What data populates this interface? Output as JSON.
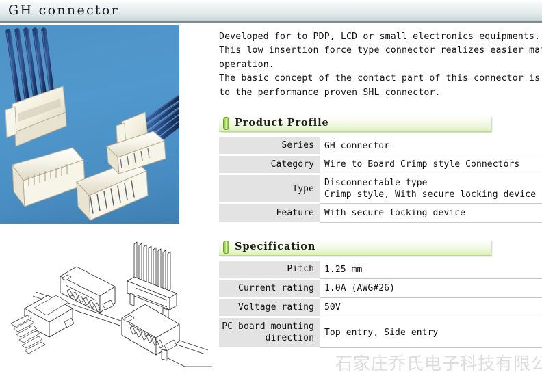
{
  "titlebar": {
    "title": "GH connector"
  },
  "photo": {
    "alt": "product-photo-gh-connector-wire-harness-and-headers"
  },
  "drawing": {
    "alt": "technical-line-drawing-gh-connector-assemblies"
  },
  "description": {
    "lines": [
      "Developed for to PDP, LCD or small electronics equipments.",
      "This low insertion force type connector realizes easier mating",
      "operation.",
      "The basic concept of the contact part of this connector is",
      "to the performance proven SHL connector."
    ]
  },
  "product_profile": {
    "header": "Product Profile",
    "icon": "green-pill-icon",
    "rows": [
      {
        "label": "Series",
        "value": "GH connector"
      },
      {
        "label": "Category",
        "value": "Wire to Board Crimp style Connectors"
      },
      {
        "label": "Type",
        "value": "Disconnectable type\nCrimp style, With secure locking device"
      },
      {
        "label": "Feature",
        "value": "With secure locking device"
      }
    ]
  },
  "specification": {
    "header": "Specification",
    "icon": "green-pill-icon",
    "rows": [
      {
        "label": "Pitch",
        "value": "1.25 mm"
      },
      {
        "label": "Current rating",
        "value": "1.0A (AWG#26)"
      },
      {
        "label": "Voltage rating",
        "value": "50V"
      },
      {
        "label": "PC board\nmounting\ndirection",
        "value": "Top entry, Side entry"
      }
    ]
  },
  "watermark": {
    "text": "石家庄乔氏电子科技有限公司"
  },
  "colors": {
    "photo_background": "#4d94cc",
    "title_bar_end": "#c2cfd2",
    "section_accent": "#7fb93c",
    "label_cell": "#e3e3e3",
    "watermark": "#dcdcdc"
  }
}
